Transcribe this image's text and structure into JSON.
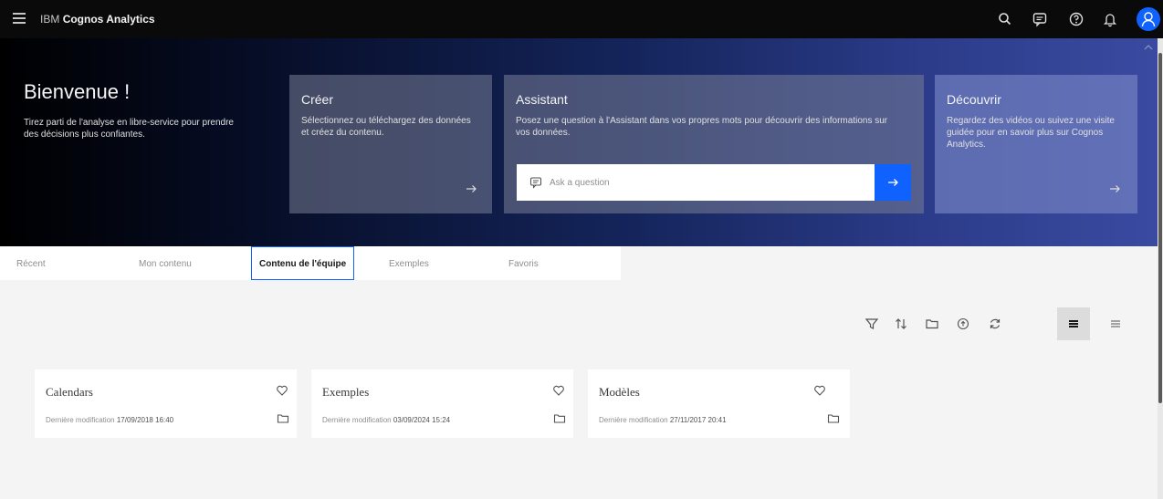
{
  "topbar": {
    "brand_prefix": "IBM",
    "brand_name": "Cognos Analytics",
    "icons": [
      "search-icon",
      "chat-icon",
      "help-icon",
      "notification-icon",
      "user-avatar-icon"
    ]
  },
  "hero": {
    "title": "Bienvenue !",
    "text": "Tirez parti de l'analyse en libre-service pour prendre des décisions plus confiantes.",
    "cards": {
      "creer": {
        "title": "Créer",
        "text": "Sélectionnez ou téléchargez des données et créez du contenu."
      },
      "assistant": {
        "title": "Assistant",
        "text": "Posez une question à l'Assistant dans vos propres mots pour découvrir des informations sur vos données.",
        "placeholder": "Ask a question"
      },
      "decouvrir": {
        "title": "Découvrir",
        "text": "Regardez des vidéos ou suivez une visite guidée pour en savoir plus sur Cognos Analytics."
      }
    }
  },
  "tabs": [
    {
      "label": "Récent"
    },
    {
      "label": "Mon contenu"
    },
    {
      "label": "Contenu de l'équipe",
      "active": true
    },
    {
      "label": "Exemples"
    },
    {
      "label": "Favoris"
    }
  ],
  "toolbar": [
    "filter-icon",
    "sort-icon",
    "new-folder-icon",
    "upload-icon",
    "refresh-icon",
    "grid-view-icon",
    "list-view-icon"
  ],
  "tiles": [
    {
      "name": "Calendars",
      "meta_label": "Dernière modification",
      "date": "17/09/2018 16:40"
    },
    {
      "name": "Exemples",
      "meta_label": "Dernière modification",
      "date": "03/09/2024 15:24"
    },
    {
      "name": "Modèles",
      "meta_label": "Dernière modification",
      "date": "27/11/2017 20:41"
    }
  ],
  "colors": {
    "accent": "#0f62fe",
    "topbar": "#0a0a0a",
    "page_bg": "#f4f4f4"
  }
}
